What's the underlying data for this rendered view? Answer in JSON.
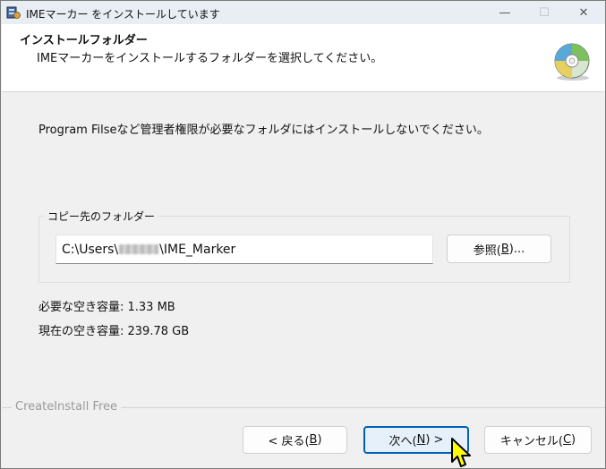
{
  "window": {
    "title": "IMEマーカー をインストールしています"
  },
  "titlebar": {
    "minimize_glyph": "—",
    "maximize_glyph": "☐",
    "close_glyph": "✕"
  },
  "header": {
    "title": "インストールフォルダー",
    "subtitle": "IMEマーカーをインストールするフォルダーを選択してください。"
  },
  "notice": "Program Filseなど管理者権限が必要なフォルダにはインストールしないでください。",
  "folder_group": {
    "legend": "コピー先のフォルダー",
    "path_prefix": "C:\\Users\\",
    "path_suffix": "\\IME_Marker",
    "browse_label": "参照(",
    "browse_key": "B",
    "browse_tail": ")..."
  },
  "space": {
    "required": "必要な空き容量: 1.33 MB",
    "available": "現在の空き容量: 239.78 GB"
  },
  "footer": {
    "brand": "CreateInstall Free"
  },
  "buttons": {
    "back": {
      "pre": "< 戻る(",
      "key": "B",
      "post": ")"
    },
    "next": {
      "pre": "次へ(",
      "key": "N",
      "post": ") >"
    },
    "cancel": {
      "pre": "キャンセル(",
      "key": "C",
      "post": ")"
    }
  },
  "colors": {
    "accent": "#005fb8",
    "titlebar": "#e8eef3",
    "background": "#f0f0f0"
  }
}
